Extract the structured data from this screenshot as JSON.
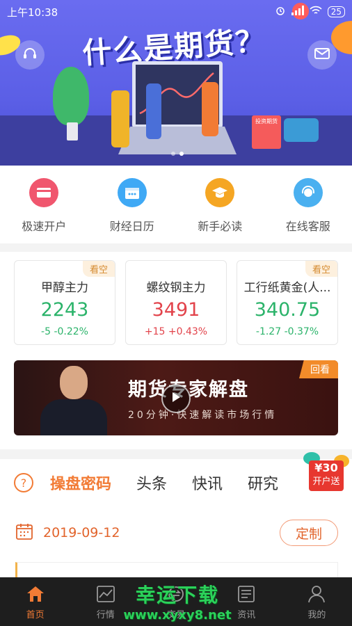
{
  "status_bar": {
    "time": "上午10:38",
    "battery": "25"
  },
  "banner": {
    "title": "什么是期货？",
    "book_label": "投资期货",
    "active_slide": 2,
    "slide_count": 2
  },
  "quick_menu": [
    {
      "label": "极速开户",
      "icon": "card-icon",
      "color": "#f0566e"
    },
    {
      "label": "财经日历",
      "icon": "calendar-icon",
      "color": "#3fa9f5"
    },
    {
      "label": "新手必读",
      "icon": "graduation-cap-icon",
      "color": "#f5a623"
    },
    {
      "label": "在线客服",
      "icon": "customer-service-icon",
      "color": "#4ab0f0"
    }
  ],
  "market_cards": [
    {
      "tag": "看空",
      "name": "甲醇主力",
      "price": "2243",
      "change": "-5",
      "percent": "-0.22%",
      "trend": "down"
    },
    {
      "tag": "",
      "name": "螺纹钢主力",
      "price": "3491",
      "change": "+15",
      "percent": "+0.43%",
      "trend": "up"
    },
    {
      "tag": "看空",
      "name": "工行纸黄金(人...",
      "price": "340.75",
      "change": "-1.27",
      "percent": "-0.37%",
      "trend": "down"
    }
  ],
  "video": {
    "tag": "回看",
    "title": "期货专家解盘",
    "subtitle": "20分钟·快速解读市场行情"
  },
  "tabs": {
    "items": [
      "操盘密码",
      "头条",
      "快讯",
      "研究"
    ],
    "active": 0
  },
  "promo": {
    "amount": "¥30",
    "text": "开户送"
  },
  "date_row": {
    "date": "2019-09-12",
    "custom_label": "定制"
  },
  "bottom_nav": [
    {
      "label": "首页",
      "icon": "home-icon",
      "active": true
    },
    {
      "label": "行情",
      "icon": "chart-icon",
      "active": false
    },
    {
      "label": "交易",
      "icon": "trade-icon",
      "active": false
    },
    {
      "label": "资讯",
      "icon": "news-icon",
      "active": false
    },
    {
      "label": "我的",
      "icon": "user-icon",
      "active": false
    }
  ],
  "watermark": {
    "main": "幸运下载",
    "sub": "www.xyxy8.net"
  },
  "colors": {
    "accent": "#f27b35",
    "up": "#e2434b",
    "down": "#2bb36a"
  }
}
